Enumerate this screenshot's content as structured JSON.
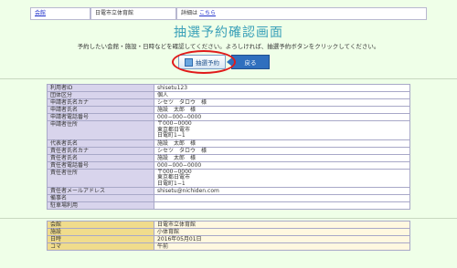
{
  "topbar": {
    "venue_link": "会館",
    "venue_name": "日電市立体育館",
    "detail_label": "詳細は",
    "detail_link": "こちら"
  },
  "page_title": "抽選予約確認画面",
  "instruction": "予約したい会館・施設・日時などを確認してください。よろしければ、抽選予約ボタンをクリックしてください。",
  "buttons": {
    "apply": "抽選予約",
    "back": "戻る"
  },
  "user_info": [
    {
      "label": "利用者ID",
      "value": "shisetu123"
    },
    {
      "label": "団体区分",
      "value": "個人"
    },
    {
      "label": "申請者氏名カナ",
      "value": "シセツ　タロウ　様"
    },
    {
      "label": "申請者氏名",
      "value": "施設　太郎　様"
    },
    {
      "label": "申請者電話番号",
      "value": "000−000−0000"
    },
    {
      "label": "申請者住所",
      "value_lines": [
        "〒000−0000",
        "東京都日電市",
        "日電町1−1"
      ]
    },
    {
      "label": "代表者氏名",
      "value": "施設　太郎　様"
    },
    {
      "label": "責任者氏名カナ",
      "value": "シセツ　タロウ　様"
    },
    {
      "label": "責任者氏名",
      "value": "施設　太郎　様"
    },
    {
      "label": "責任者電話番号",
      "value": "000−000−0000"
    },
    {
      "label": "責任者住所",
      "value_lines": [
        "〒000−0000",
        "東京都日電市",
        "日電町1−1"
      ]
    },
    {
      "label": "責任者メールアドレス",
      "value": "shisetu@nichiden.com"
    },
    {
      "label": "備事名",
      "value": ""
    },
    {
      "label": "駐車場利用",
      "value": ""
    }
  ],
  "booking_info": [
    {
      "label": "会館",
      "value": "日電市立体育館"
    },
    {
      "label": "施設",
      "value": "小体育館"
    },
    {
      "label": "日時",
      "value": "2016年05月01日"
    },
    {
      "label": "コマ",
      "value": "午前"
    }
  ]
}
